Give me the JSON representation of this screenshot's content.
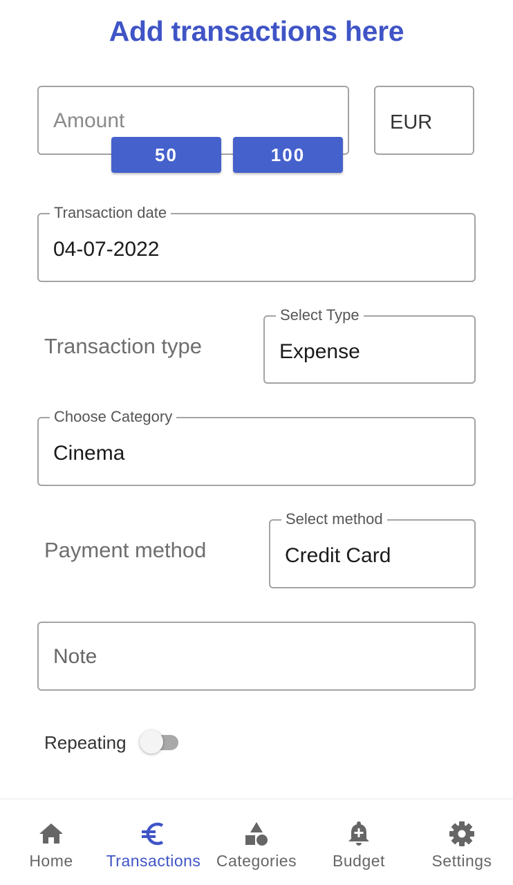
{
  "header": {
    "title": "Add transactions here"
  },
  "amount": {
    "placeholder": "Amount",
    "currency": "EUR",
    "quick_amounts": [
      "50",
      "100"
    ]
  },
  "date": {
    "label": "Transaction date",
    "value": "04-07-2022"
  },
  "type": {
    "row_label": "Transaction type",
    "label": "Select Type",
    "value": "Expense"
  },
  "category": {
    "label": "Choose Category",
    "value": "Cinema"
  },
  "method": {
    "row_label": "Payment method",
    "label": "Select method",
    "value": "Credit Card"
  },
  "note": {
    "placeholder": "Note"
  },
  "repeating": {
    "label": "Repeating",
    "enabled": false
  },
  "nav": {
    "active": "Transactions",
    "accent": "#3f54c6",
    "items": [
      {
        "label": "Home",
        "icon": "home-icon"
      },
      {
        "label": "Transactions",
        "icon": "euro-icon"
      },
      {
        "label": "Categories",
        "icon": "shapes-icon"
      },
      {
        "label": "Budget",
        "icon": "bell-plus-icon"
      },
      {
        "label": "Settings",
        "icon": "gear-icon"
      }
    ]
  }
}
